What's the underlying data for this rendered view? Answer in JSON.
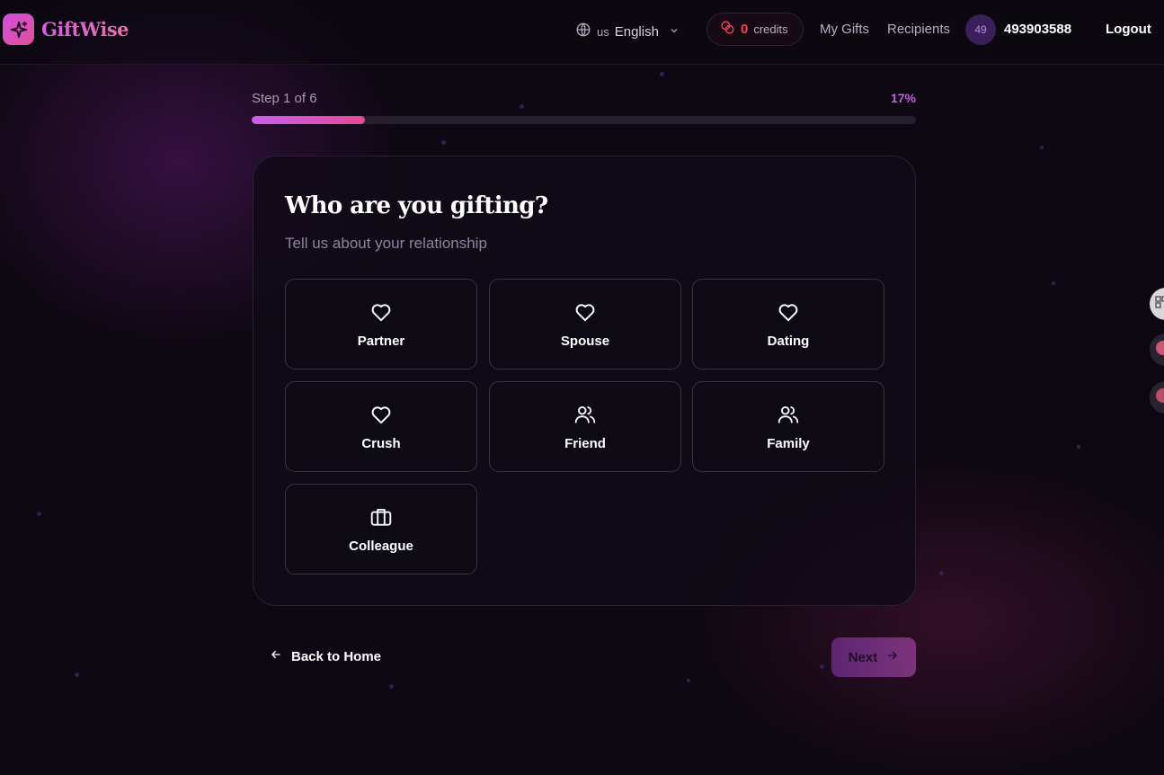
{
  "header": {
    "brand": "GiftWise",
    "language": {
      "flag": "us",
      "label": "English"
    },
    "credits": {
      "count": "0",
      "label": "credits"
    },
    "nav": {
      "my_gifts": "My Gifts",
      "recipients": "Recipients"
    },
    "user": {
      "avatar_text": "49",
      "name": "493903588"
    },
    "logout": "Logout"
  },
  "progress": {
    "step_label": "Step 1 of 6",
    "percent_label": "17%",
    "fraction": 0.17
  },
  "question": {
    "title": "Who are you gifting?",
    "subtitle": "Tell us about your relationship"
  },
  "options": [
    {
      "label": "Partner",
      "icon": "heart-icon"
    },
    {
      "label": "Spouse",
      "icon": "heart-icon"
    },
    {
      "label": "Dating",
      "icon": "heart-icon"
    },
    {
      "label": "Crush",
      "icon": "heart-icon"
    },
    {
      "label": "Friend",
      "icon": "users-icon"
    },
    {
      "label": "Family",
      "icon": "users-icon"
    },
    {
      "label": "Colleague",
      "icon": "briefcase-icon"
    }
  ],
  "footer": {
    "back_label": "Back to Home",
    "next_label": "Next"
  },
  "colors": {
    "accent": "#c95ff0",
    "accent_pink": "#e54a95",
    "credits_red": "#f2425a"
  }
}
